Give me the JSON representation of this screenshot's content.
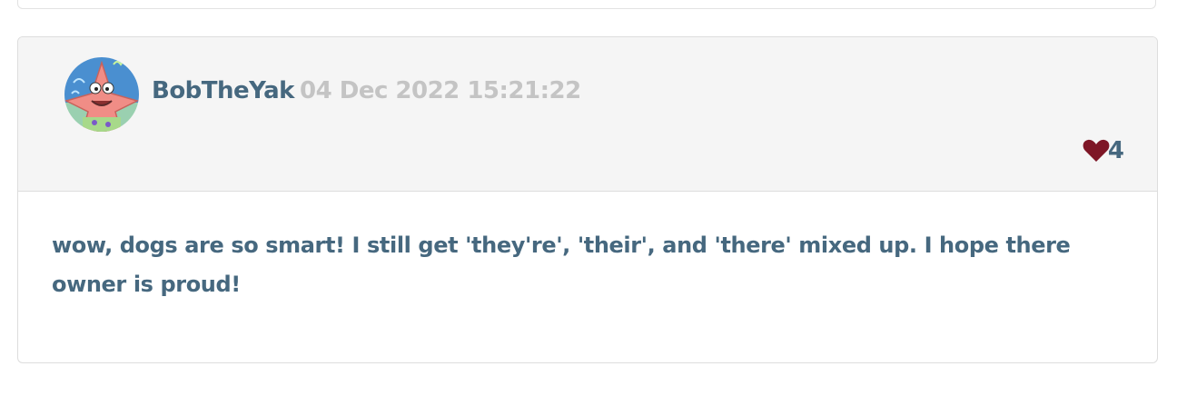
{
  "comment": {
    "author": "BobTheYak",
    "timestamp": "04 Dec 2022 15:21:22",
    "like_count": "4",
    "body": "wow, dogs are so smart! I still get 'they're', 'their', and 'there' mixed up. I hope there owner is proud!",
    "avatar_icon": "cartoon-starfish-avatar",
    "like_icon": "heart-icon"
  },
  "colors": {
    "text_primary": "#46687f",
    "timestamp": "#c4c4c4",
    "heart": "#7e1626",
    "header_bg": "#f5f5f5",
    "border": "#dddddd"
  }
}
